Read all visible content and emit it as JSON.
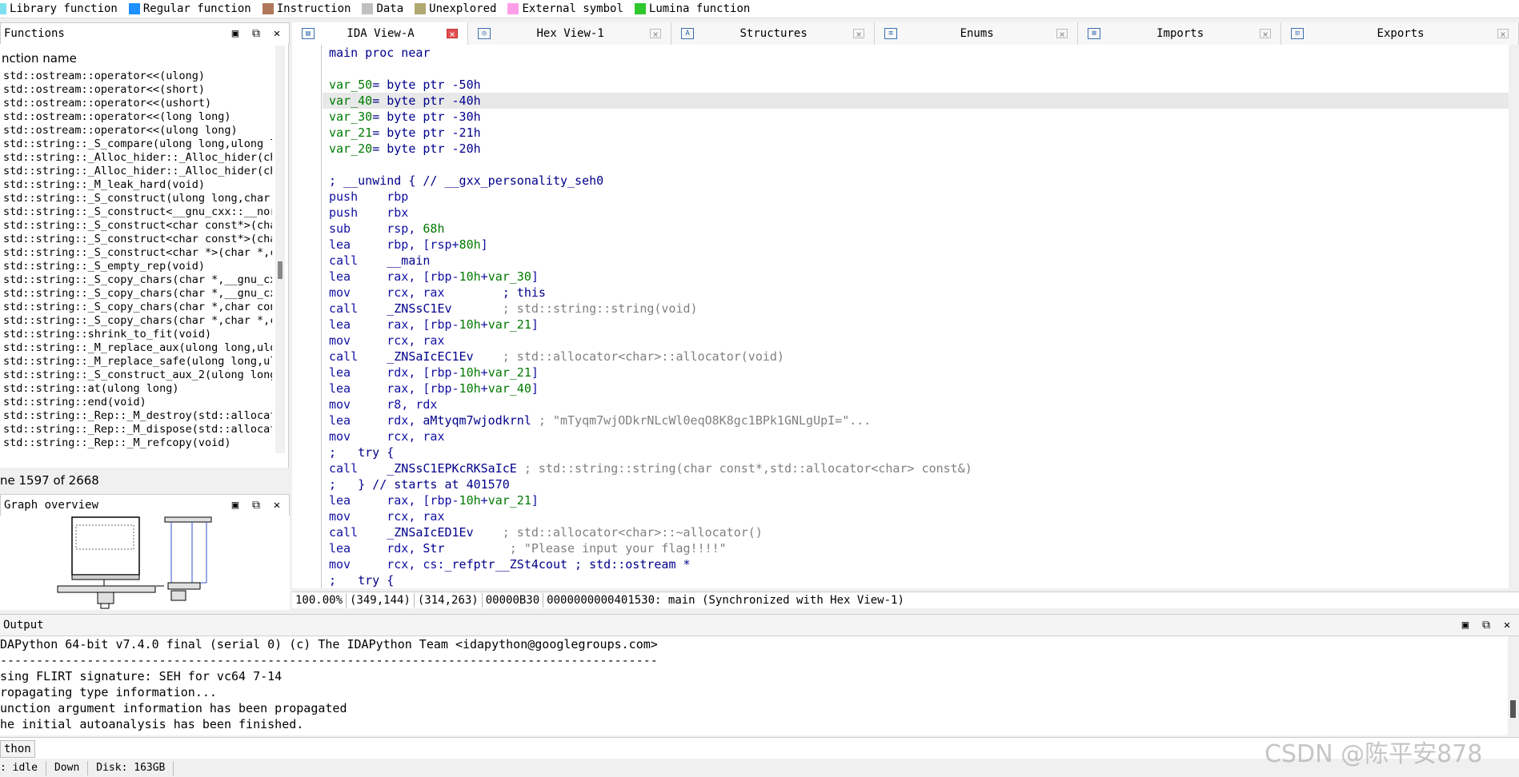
{
  "legend": {
    "items": [
      {
        "label": "Library function",
        "color": "#7ee0f0"
      },
      {
        "label": "Regular function",
        "color": "#1e90ff"
      },
      {
        "label": "Instruction",
        "color": "#b0785a"
      },
      {
        "label": "Data",
        "color": "#c0c0c0"
      },
      {
        "label": "Unexplored",
        "color": "#b0a870"
      },
      {
        "label": "External symbol",
        "color": "#ff9ee8"
      },
      {
        "label": "Lumina function",
        "color": "#2ec82e"
      }
    ]
  },
  "functions_panel": {
    "title": "Functions",
    "column_header": "nction name",
    "rows": [
      "std::ostream::operator<<(ulong)",
      "std::ostream::operator<<(short)",
      "std::ostream::operator<<(ushort)",
      "std::ostream::operator<<(long long)",
      "std::ostream::operator<<(ulong long)",
      "std::string::_S_compare(ulong long,ulong l",
      "std::string::_Alloc_hider::_Alloc_hider(ch",
      "std::string::_Alloc_hider::_Alloc_hider(ch",
      "std::string::_M_leak_hard(void)",
      "std::string::_S_construct(ulong long,char,",
      "std::string::_S_construct<__gnu_cxx::__nor",
      "std::string::_S_construct<char const*>(cha",
      "std::string::_S_construct<char const*>(cha",
      "std::string::_S_construct<char *>(char *,c",
      "std::string::_S_empty_rep(void)",
      "std::string::_S_copy_chars(char *,__gnu_cx",
      "std::string::_S_copy_chars(char *,__gnu_cx",
      "std::string::_S_copy_chars(char *,char con",
      "std::string::_S_copy_chars(char *,char *,c",
      "std::string::shrink_to_fit(void)",
      "std::string::_M_replace_aux(ulong long,ulo",
      "std::string::_M_replace_safe(ulong long,ul",
      "std::string::_S_construct_aux_2(ulong long",
      "std::string::at(ulong long)",
      "std::string::end(void)",
      "std::string::_Rep::_M_destroy(std::allocat",
      "std::string::_Rep::_M_dispose(std::allocat",
      "std::string::_Rep::_M_refcopy(void)"
    ],
    "line_status": "ne 1597 of 2668"
  },
  "graph_panel": {
    "title": "Graph overview"
  },
  "tabs": [
    {
      "label": "IDA View-A",
      "icon": "ida-view-icon",
      "active": true
    },
    {
      "label": "Hex View-1",
      "icon": "hex-view-icon",
      "active": false
    },
    {
      "label": "Structures",
      "icon": "structures-icon",
      "active": false
    },
    {
      "label": "Enums",
      "icon": "enums-icon",
      "active": false
    },
    {
      "label": "Imports",
      "icon": "imports-icon",
      "active": false
    },
    {
      "label": "Exports",
      "icon": "exports-icon",
      "active": false
    }
  ],
  "disasm_lines": [
    {
      "segs": [
        {
          "t": "main proc near",
          "c": "c-blue"
        }
      ]
    },
    {
      "segs": []
    },
    {
      "segs": [
        {
          "t": "var_50",
          "c": "c-green"
        },
        {
          "t": "= byte ptr -50h",
          "c": "c-blue"
        }
      ]
    },
    {
      "segs": [
        {
          "t": "var_40",
          "c": "c-green"
        },
        {
          "t": "= byte ptr -40h",
          "c": "c-blue"
        }
      ],
      "hl": true
    },
    {
      "segs": [
        {
          "t": "var_30",
          "c": "c-green"
        },
        {
          "t": "= byte ptr -30h",
          "c": "c-blue"
        }
      ]
    },
    {
      "segs": [
        {
          "t": "var_21",
          "c": "c-green"
        },
        {
          "t": "= byte ptr -21h",
          "c": "c-blue"
        }
      ]
    },
    {
      "segs": [
        {
          "t": "var_20",
          "c": "c-green"
        },
        {
          "t": "= byte ptr -20h",
          "c": "c-blue"
        }
      ]
    },
    {
      "segs": []
    },
    {
      "segs": [
        {
          "t": "; __unwind { // __gxx_personality_seh0",
          "c": "c-blue"
        }
      ]
    },
    {
      "segs": [
        {
          "t": "push    rbp",
          "c": "c-navy"
        }
      ]
    },
    {
      "segs": [
        {
          "t": "push    rbx",
          "c": "c-navy"
        }
      ]
    },
    {
      "segs": [
        {
          "t": "sub     rsp, ",
          "c": "c-navy"
        },
        {
          "t": "68h",
          "c": "c-green"
        }
      ]
    },
    {
      "segs": [
        {
          "t": "lea     rbp, [rsp+",
          "c": "c-navy"
        },
        {
          "t": "80h",
          "c": "c-green"
        },
        {
          "t": "]",
          "c": "c-navy"
        }
      ]
    },
    {
      "segs": [
        {
          "t": "call    ",
          "c": "c-navy"
        },
        {
          "t": "__main",
          "c": "c-blue"
        }
      ]
    },
    {
      "segs": [
        {
          "t": "lea     rax, [rbp-",
          "c": "c-navy"
        },
        {
          "t": "10h",
          "c": "c-green"
        },
        {
          "t": "+",
          "c": "c-navy"
        },
        {
          "t": "var_30",
          "c": "c-green"
        },
        {
          "t": "]",
          "c": "c-navy"
        }
      ]
    },
    {
      "segs": [
        {
          "t": "mov     rcx, rax        ",
          "c": "c-navy"
        },
        {
          "t": "; this",
          "c": "c-blue"
        }
      ]
    },
    {
      "segs": [
        {
          "t": "call    ",
          "c": "c-navy"
        },
        {
          "t": "_ZNSsC1Ev",
          "c": "c-blue"
        },
        {
          "t": "       ; std::string::string(void)",
          "c": "c-gray"
        }
      ]
    },
    {
      "segs": [
        {
          "t": "lea     rax, [rbp-",
          "c": "c-navy"
        },
        {
          "t": "10h",
          "c": "c-green"
        },
        {
          "t": "+",
          "c": "c-navy"
        },
        {
          "t": "var_21",
          "c": "c-green"
        },
        {
          "t": "]",
          "c": "c-navy"
        }
      ]
    },
    {
      "segs": [
        {
          "t": "mov     rcx, rax",
          "c": "c-navy"
        }
      ]
    },
    {
      "segs": [
        {
          "t": "call    ",
          "c": "c-navy"
        },
        {
          "t": "_ZNSaIcEC1Ev",
          "c": "c-blue"
        },
        {
          "t": "    ; std::allocator<char>::allocator(void)",
          "c": "c-gray"
        }
      ]
    },
    {
      "segs": [
        {
          "t": "lea     rdx, [rbp-",
          "c": "c-navy"
        },
        {
          "t": "10h",
          "c": "c-green"
        },
        {
          "t": "+",
          "c": "c-navy"
        },
        {
          "t": "var_21",
          "c": "c-green"
        },
        {
          "t": "]",
          "c": "c-navy"
        }
      ]
    },
    {
      "segs": [
        {
          "t": "lea     rax, [rbp-",
          "c": "c-navy"
        },
        {
          "t": "10h",
          "c": "c-green"
        },
        {
          "t": "+",
          "c": "c-navy"
        },
        {
          "t": "var_40",
          "c": "c-green"
        },
        {
          "t": "]",
          "c": "c-navy"
        }
      ]
    },
    {
      "segs": [
        {
          "t": "mov     r8, rdx",
          "c": "c-navy"
        }
      ]
    },
    {
      "segs": [
        {
          "t": "lea     rdx, ",
          "c": "c-navy"
        },
        {
          "t": "aMtyqm7wjodkrnl",
          "c": "c-blue"
        },
        {
          "t": " ; \"mTyqm7wjODkrNLcWl0eqO8K8gc1BPk1GNLgUpI=\"...",
          "c": "c-gray"
        }
      ]
    },
    {
      "segs": [
        {
          "t": "mov     rcx, rax",
          "c": "c-navy"
        }
      ]
    },
    {
      "segs": [
        {
          "t": ";   try {",
          "c": "c-blue"
        }
      ]
    },
    {
      "segs": [
        {
          "t": "call    ",
          "c": "c-navy"
        },
        {
          "t": "_ZNSsC1EPKcRKSaIcE",
          "c": "c-blue"
        },
        {
          "t": " ; std::string::string(char const*,std::allocator<char> const&)",
          "c": "c-gray"
        }
      ]
    },
    {
      "segs": [
        {
          "t": ";   } // starts at 401570",
          "c": "c-blue"
        }
      ]
    },
    {
      "segs": [
        {
          "t": "lea     rax, [rbp-",
          "c": "c-navy"
        },
        {
          "t": "10h",
          "c": "c-green"
        },
        {
          "t": "+",
          "c": "c-navy"
        },
        {
          "t": "var_21",
          "c": "c-green"
        },
        {
          "t": "]",
          "c": "c-navy"
        }
      ]
    },
    {
      "segs": [
        {
          "t": "mov     rcx, rax",
          "c": "c-navy"
        }
      ]
    },
    {
      "segs": [
        {
          "t": "call    ",
          "c": "c-navy"
        },
        {
          "t": "_ZNSaIcED1Ev",
          "c": "c-blue"
        },
        {
          "t": "    ; std::allocator<char>::~allocator()",
          "c": "c-gray"
        }
      ]
    },
    {
      "segs": [
        {
          "t": "lea     rdx, ",
          "c": "c-navy"
        },
        {
          "t": "Str",
          "c": "c-blue"
        },
        {
          "t": "         ; \"Please input your flag!!!!\"",
          "c": "c-gray"
        }
      ]
    },
    {
      "segs": [
        {
          "t": "mov     rcx, cs:",
          "c": "c-navy"
        },
        {
          "t": "_refptr__ZSt4cout",
          "c": "c-blue"
        },
        {
          "t": " ; std::ostream *",
          "c": "c-blue"
        }
      ]
    },
    {
      "segs": [
        {
          "t": ";   try {",
          "c": "c-blue"
        }
      ]
    }
  ],
  "view_status": {
    "zoom": "100.00%",
    "cursor_pos": "(349,144)",
    "graph_pos": "(314,263)",
    "offset": "00000B30",
    "address_info": "0000000000401530: main (Synchronized with Hex View-1)"
  },
  "output_panel": {
    "title": "Output",
    "lines": [
      "DAPython 64-bit v7.4.0 final (serial 0) (c) The IDAPython Team <idapython@googlegroups.com>",
      "-------------------------------------------------------------------------------------------",
      "sing FLIRT signature: SEH for vc64 7-14",
      "ropagating type information...",
      "unction argument information has been propagated",
      "he initial autoanalysis has been finished."
    ],
    "cli_label": "thon"
  },
  "bottom_status": {
    "state": ":  idle",
    "direction": "Down",
    "disk": "Disk: 163GB"
  },
  "watermark": "CSDN @陈平安878"
}
